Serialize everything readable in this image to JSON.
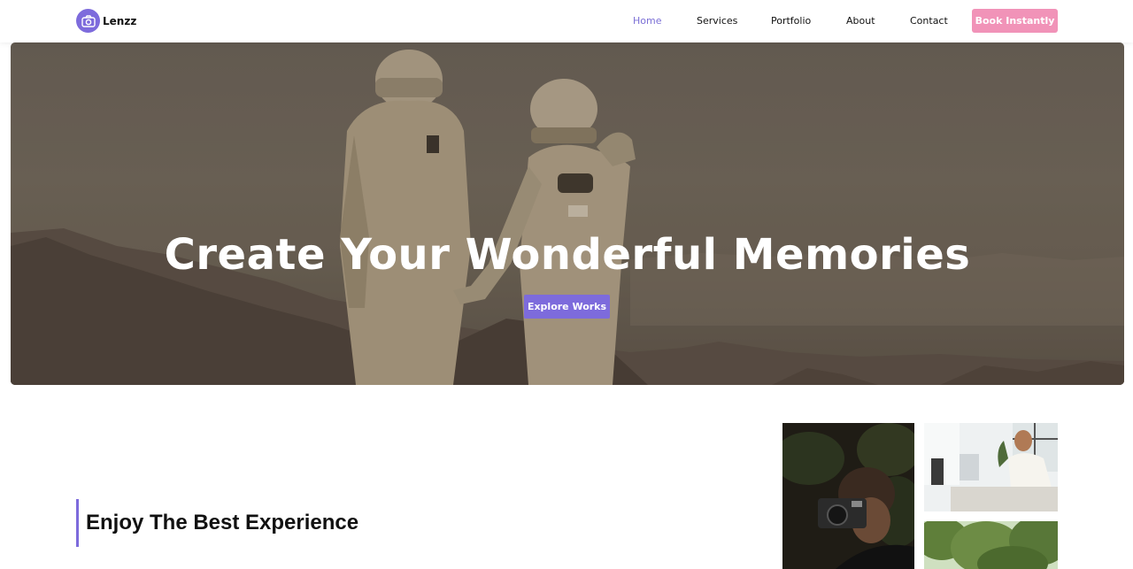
{
  "brand": {
    "name": "Lenzz",
    "logo_icon": "camera-icon",
    "logo_color": "#7d6bdc"
  },
  "nav": {
    "items": [
      {
        "label": "Home",
        "active": true
      },
      {
        "label": "Services",
        "active": false
      },
      {
        "label": "Portfolio",
        "active": false
      },
      {
        "label": "About",
        "active": false
      },
      {
        "label": "Contact",
        "active": false
      }
    ],
    "cta_label": "Book Instantly",
    "cta_color": "#f193b8",
    "active_color": "#7b6fd6"
  },
  "hero": {
    "title": "Create Your Wonderful Memories",
    "button_label": "Explore Works",
    "button_color": "#7d6bdc",
    "image": "two astronauts holding hands in a desert landscape"
  },
  "section": {
    "title": "Enjoy The Best Experience",
    "accent_color": "#7d6bdc"
  },
  "gallery": {
    "photos": [
      {
        "subject": "person holding a camera among leaves"
      },
      {
        "subject": "smiling man working at a desk by a window"
      },
      {
        "subject": "green trees"
      }
    ]
  }
}
